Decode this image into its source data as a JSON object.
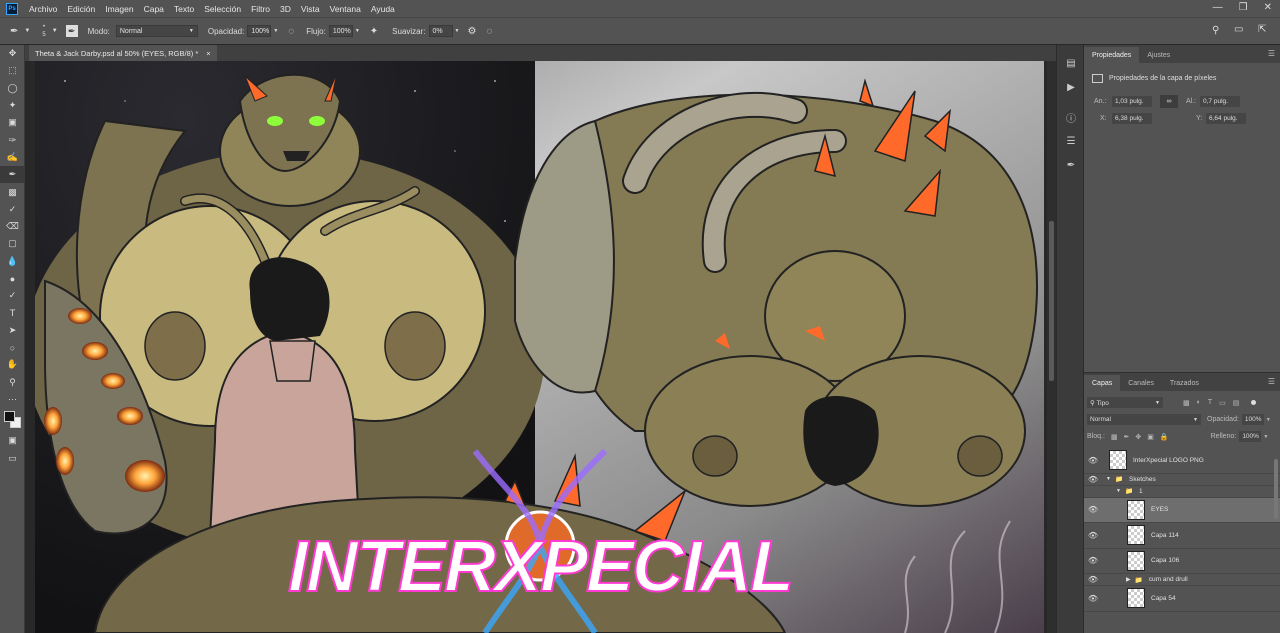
{
  "menubar": {
    "logo": "Ps",
    "items": [
      "Archivo",
      "Edición",
      "Imagen",
      "Capa",
      "Texto",
      "Selección",
      "Filtro",
      "3D",
      "Vista",
      "Ventana",
      "Ayuda"
    ]
  },
  "options": {
    "brush_size": "5",
    "mode_label": "Modo:",
    "mode_value": "Normal",
    "opacity_label": "Opacidad:",
    "opacity_value": "100%",
    "flow_label": "Flujo:",
    "flow_value": "100%",
    "smooth_label": "Suavizar:",
    "smooth_value": "0%"
  },
  "document": {
    "tab_title": "Theta & Jack Darby.psd al 50% (EYES, RGB/8) *",
    "close": "×",
    "artwork_logo_text": "INTERXPECIAL"
  },
  "properties": {
    "tabs": [
      "Propiedades",
      "Ajustes"
    ],
    "header": "Propiedades de la capa de píxeles",
    "width_label": "An.:",
    "width_value": "1,03 pulg.",
    "height_label": "Al.:",
    "height_value": "0,7 pulg.",
    "x_label": "X:",
    "x_value": "6,38 pulg.",
    "y_label": "Y:",
    "y_value": "6,64 pulg."
  },
  "layers_panel": {
    "tabs": [
      "Capas",
      "Canales",
      "Trazados"
    ],
    "filter_value": "Tipo",
    "blend_value": "Normal",
    "opacity_label": "Opacidad:",
    "opacity_value": "100%",
    "lock_label": "Bloq.:",
    "fill_label": "Relleno:",
    "fill_value": "100%",
    "layers": [
      {
        "name": "InterXpecial LOGO PNG",
        "type": "layer",
        "selected": false
      },
      {
        "name": "Sketches",
        "type": "group",
        "selected": false
      },
      {
        "name": "1",
        "type": "group",
        "selected": false
      },
      {
        "name": "EYES",
        "type": "layer",
        "selected": true
      },
      {
        "name": "Capa 114",
        "type": "layer",
        "selected": false
      },
      {
        "name": "Capa 106",
        "type": "layer",
        "selected": false
      },
      {
        "name": "cum and drull",
        "type": "group",
        "selected": false
      },
      {
        "name": "Capa 54",
        "type": "layer",
        "selected": false
      }
    ]
  },
  "colors": {
    "accent_orange": "#ff6a2a",
    "creature_skin": "#8a7a52",
    "panel_bg": "#535353",
    "dark_bg": "#282828"
  }
}
